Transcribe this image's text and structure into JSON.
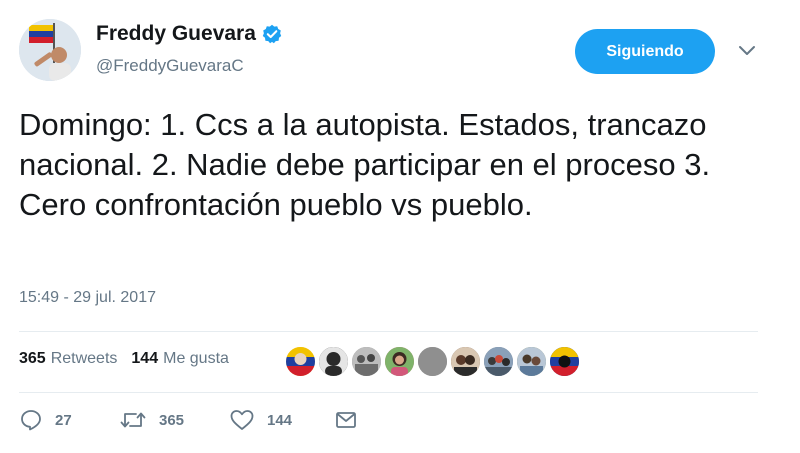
{
  "tweet": {
    "author": {
      "name": "Freddy Guevara",
      "handle": "@FreddyGuevaraC",
      "verified": true
    },
    "follow_button_label": "Siguiendo",
    "text": "Domingo: 1. Ccs a la autopista. Estados, trancazo nacional. 2. Nadie debe participar en el proceso 3. Cero confrontación pueblo vs pueblo.",
    "timestamp": "15:49 - 29 jul. 2017",
    "stats": {
      "retweets_count": "365",
      "retweets_label": "Retweets",
      "likes_count": "144",
      "likes_label": "Me gusta"
    },
    "likers": [
      {
        "icon": "venezuela-flag-avatar",
        "color": "#f2c94c"
      },
      {
        "icon": "person-avatar",
        "color": "#3a3a3a"
      },
      {
        "icon": "group-photo-avatar",
        "color": "#8a8a8a"
      },
      {
        "icon": "woman-avatar",
        "color": "#c56a7a"
      },
      {
        "icon": "gray-avatar",
        "color": "#8f8f8f"
      },
      {
        "icon": "couple-avatar",
        "color": "#7a5a45"
      },
      {
        "icon": "crowd-avatar",
        "color": "#5b6e8a"
      },
      {
        "icon": "family-avatar",
        "color": "#6e7f5a"
      },
      {
        "icon": "flag-avatar",
        "color": "#1f3a7a"
      }
    ],
    "actions": {
      "reply_count": "27",
      "retweet_count": "365",
      "like_count": "144"
    },
    "colors": {
      "accent": "#1da1f2",
      "muted": "#657786",
      "divider": "#e6ecf0"
    }
  }
}
